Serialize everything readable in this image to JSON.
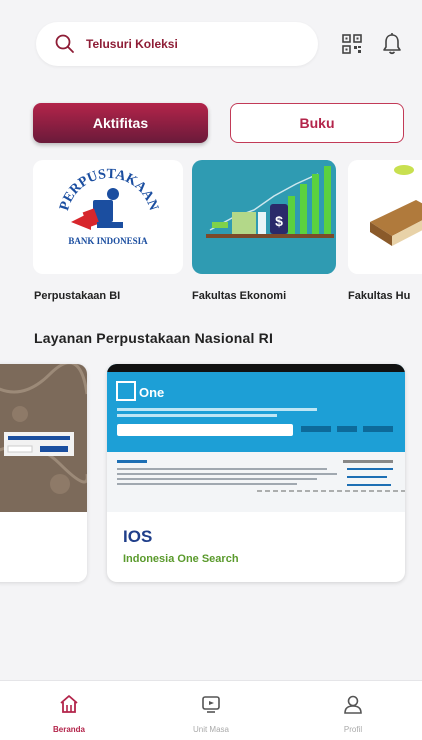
{
  "search": {
    "label": "Telusuri Koleksi",
    "icon": "search-icon"
  },
  "header_icons": {
    "qr": "qr-code-icon",
    "bell": "bell-icon"
  },
  "tabs": [
    {
      "label": "Aktifitas",
      "active": true
    },
    {
      "label": "Buku",
      "active": false
    }
  ],
  "collections": [
    {
      "label": "Perpustakaan BI",
      "logo_top_text": "PERPUSTAKAAN",
      "logo_bottom_text": "BANK INDONESIA"
    },
    {
      "label": "Fakultas Ekonomi"
    },
    {
      "label": "Fakultas Hu"
    }
  ],
  "section": {
    "title": "Layanan Perpustakaan Nasional RI"
  },
  "services": [
    {
      "title": "IOS",
      "subtitle": "Indonesia One Search"
    }
  ],
  "bottom_nav": [
    {
      "label": "Beranda",
      "icon": "home-icon",
      "active": true
    },
    {
      "label": "Unit Masa",
      "icon": "tv-icon",
      "active": false
    },
    {
      "label": "Profil",
      "icon": "user-icon",
      "active": false
    }
  ],
  "colors": {
    "brand": "#b3244a",
    "brand_dark": "#6a1a3a",
    "ios_blue": "#1f3e8a",
    "ios_green": "#5a9a2c",
    "ekonomi_teal": "#2f9bb2"
  }
}
